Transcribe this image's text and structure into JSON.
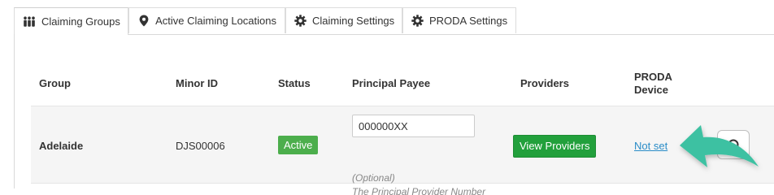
{
  "tabs": [
    {
      "label": "Claiming Groups",
      "icon": "group-icon",
      "active": true
    },
    {
      "label": "Active Claiming Locations",
      "icon": "location-pin-icon",
      "active": false
    },
    {
      "label": "Claiming Settings",
      "icon": "gear-icon",
      "active": false
    },
    {
      "label": "PRODA Settings",
      "icon": "gear-icon",
      "active": false
    }
  ],
  "table": {
    "headers": {
      "group": "Group",
      "minor_id": "Minor ID",
      "status": "Status",
      "principal_payee": "Principal Payee",
      "providers": "Providers",
      "proda_device_line1": "PRODA",
      "proda_device_line2": "Device"
    },
    "rows": [
      {
        "group": "Adelaide",
        "minor_id": "DJS00006",
        "status": "Active",
        "principal_payee_value": "000000XX",
        "principal_payee_help_line1": "(Optional)",
        "principal_payee_help_line2": "The Principal Provider Number",
        "providers_button": "View Providers",
        "proda_device": "Not set"
      }
    ]
  },
  "colors": {
    "status_active": "#4cae4c",
    "providers_button": "#22a03c",
    "link": "#2a8cc7",
    "arrow": "#3ec1a2"
  }
}
